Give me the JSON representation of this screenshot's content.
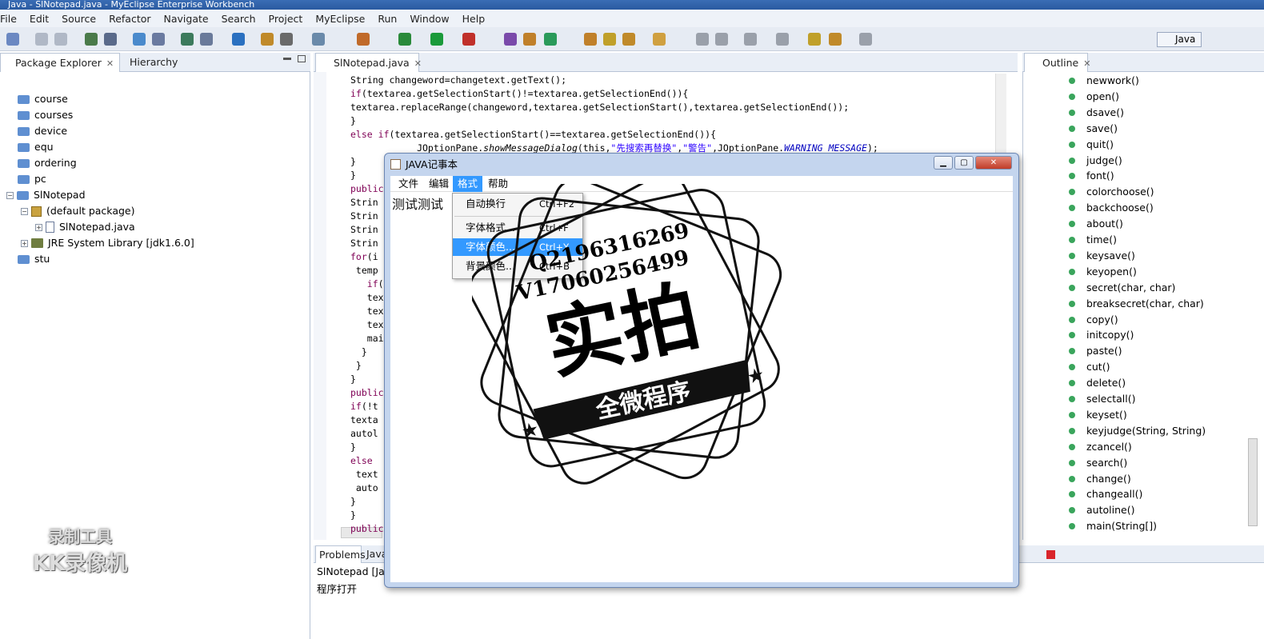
{
  "window": {
    "title": "Java - SlNotepad.java - MyEclipse Enterprise Workbench"
  },
  "menubar": [
    "File",
    "Edit",
    "Source",
    "Refactor",
    "Navigate",
    "Search",
    "Project",
    "MyEclipse",
    "Run",
    "Window",
    "Help"
  ],
  "perspective": {
    "label": "Java"
  },
  "left_panel": {
    "tabs": [
      "Package Explorer",
      "Hierarchy"
    ],
    "tree": [
      {
        "label": "course",
        "indent": 0,
        "kind": "folder"
      },
      {
        "label": "courses",
        "indent": 0,
        "kind": "folder"
      },
      {
        "label": "device",
        "indent": 0,
        "kind": "folder"
      },
      {
        "label": "equ",
        "indent": 0,
        "kind": "folder"
      },
      {
        "label": "ordering",
        "indent": 0,
        "kind": "folder"
      },
      {
        "label": "pc",
        "indent": 0,
        "kind": "folder"
      },
      {
        "label": "SlNotepad",
        "indent": 0,
        "kind": "project"
      },
      {
        "label": "(default package)",
        "indent": 1,
        "kind": "package"
      },
      {
        "label": "SlNotepad.java",
        "indent": 2,
        "kind": "java"
      },
      {
        "label": "JRE System Library [jdk1.6.0]",
        "indent": 1,
        "kind": "library"
      },
      {
        "label": "stu",
        "indent": 0,
        "kind": "folder"
      }
    ]
  },
  "editor": {
    "tab": "SlNotepad.java",
    "lines": [
      "String changeword=changetext.getText();",
      "if(textarea.getSelectionStart()!=textarea.getSelectionEnd()){",
      "textarea.replaceRange(changeword,textarea.getSelectionStart(),textarea.getSelectionEnd());",
      "}",
      "else if(textarea.getSelectionStart()==textarea.getSelectionEnd()){",
      "            JOptionPane.showMessageDialog(this,\"先搜索再替换\",\"警告\",JOptionPane.WARNING_MESSAGE);",
      "}",
      "}",
      "public",
      "Strin",
      "Strin",
      "Strin",
      "Strin",
      "for(i",
      " temp",
      "   if(",
      "   tex",
      "   tex",
      "   tex",
      "   mai",
      "  }",
      " }",
      "}",
      "public",
      "if(!t",
      "texta",
      "autol",
      "}",
      "else",
      " text",
      " auto",
      "}",
      "}",
      "public"
    ]
  },
  "outline": {
    "tab": "Outline",
    "items": [
      "newwork()",
      "open()",
      "dsave()",
      "save()",
      "quit()",
      "judge()",
      "font()",
      "colorchoose()",
      "backchoose()",
      "about()",
      "time()",
      "keysave()",
      "keyopen()",
      "secret(char, char)",
      "breaksecret(char, char)",
      "copy()",
      "initcopy()",
      "paste()",
      "cut()",
      "delete()",
      "selectall()",
      "keyset()",
      "keyjudge(String, String)",
      "zcancel()",
      "search()",
      "change()",
      "changeall()",
      "autoline()",
      "main(String[])"
    ]
  },
  "bottom": {
    "tabs": [
      "Problems",
      "Java"
    ],
    "console_title": "SlNotepad [Ja",
    "console_line": "程序打开"
  },
  "dialog": {
    "title": "JAVA记事本",
    "menus": [
      "文件",
      "编辑",
      "格式",
      "帮助"
    ],
    "text": "测试测试",
    "dropdown": [
      {
        "label": "自动换行",
        "accel": "Ctrl+F2",
        "selected": false
      },
      {
        "label": "字体格式...",
        "accel": "Ctrl+F",
        "selected": false
      },
      {
        "label": "字体颜色...",
        "accel": "Ctrl+Y",
        "selected": true
      },
      {
        "label": "背景颜色...",
        "accel": "Ctrl+B",
        "selected": false
      }
    ]
  },
  "watermark": {
    "qq": "Q2196316269",
    "vx": "V17060256499",
    "big": "实拍",
    "banner": "全微程序"
  },
  "recorder_logo": {
    "line1": "录制工具",
    "line2": "KK录像机"
  },
  "colors": {
    "accent": "#3399ff",
    "keyword": "#7f0055",
    "string": "#2a00ff",
    "method_dot": "#3aa55c"
  }
}
